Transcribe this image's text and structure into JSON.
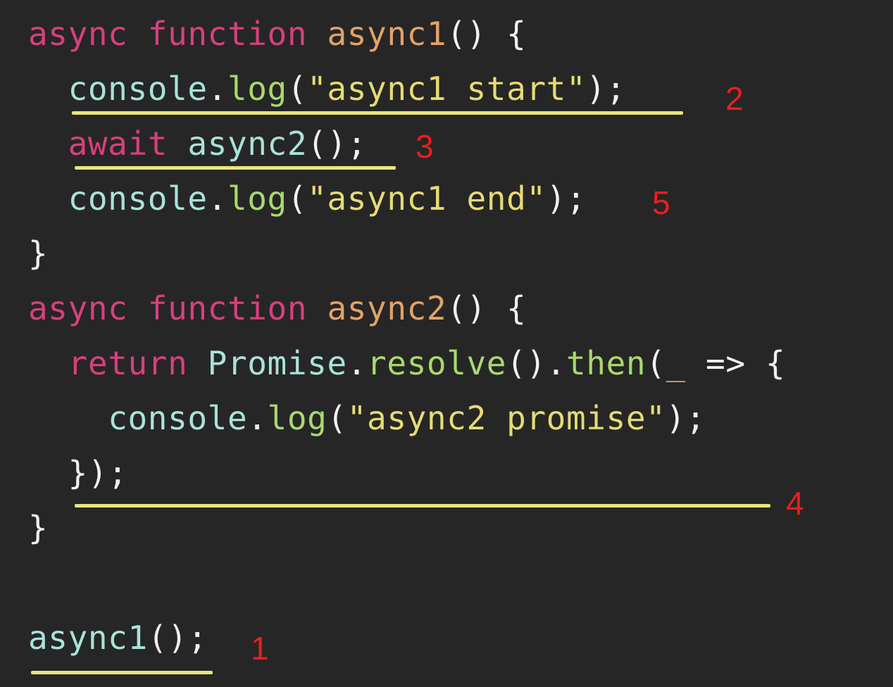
{
  "lines": [
    {
      "id": "line-1",
      "tokens": [
        {
          "text": "async",
          "kind": "keyword"
        },
        {
          "text": " ",
          "kind": "space"
        },
        {
          "text": "function",
          "kind": "keyword"
        },
        {
          "text": " ",
          "kind": "space"
        },
        {
          "text": "async1",
          "kind": "function-name"
        },
        {
          "text": "() {",
          "kind": "punctuation"
        }
      ]
    },
    {
      "id": "line-2",
      "tokens": [
        {
          "text": "  ",
          "kind": "space"
        },
        {
          "text": "console",
          "kind": "identifier"
        },
        {
          "text": ".",
          "kind": "punctuation"
        },
        {
          "text": "log",
          "kind": "method"
        },
        {
          "text": "(",
          "kind": "punctuation"
        },
        {
          "text": "\"async1 start\"",
          "kind": "string"
        },
        {
          "text": ");",
          "kind": "punctuation"
        }
      ]
    },
    {
      "id": "line-3",
      "tokens": [
        {
          "text": "  ",
          "kind": "space"
        },
        {
          "text": "await",
          "kind": "keyword"
        },
        {
          "text": " ",
          "kind": "space"
        },
        {
          "text": "async2",
          "kind": "identifier"
        },
        {
          "text": "();",
          "kind": "punctuation"
        }
      ]
    },
    {
      "id": "line-4",
      "tokens": [
        {
          "text": "  ",
          "kind": "space"
        },
        {
          "text": "console",
          "kind": "identifier"
        },
        {
          "text": ".",
          "kind": "punctuation"
        },
        {
          "text": "log",
          "kind": "method"
        },
        {
          "text": "(",
          "kind": "punctuation"
        },
        {
          "text": "\"async1 end\"",
          "kind": "string"
        },
        {
          "text": ");",
          "kind": "punctuation"
        }
      ]
    },
    {
      "id": "line-5",
      "tokens": [
        {
          "text": "}",
          "kind": "punctuation"
        }
      ]
    },
    {
      "id": "line-6",
      "tokens": [
        {
          "text": "async",
          "kind": "keyword"
        },
        {
          "text": " ",
          "kind": "space"
        },
        {
          "text": "function",
          "kind": "keyword"
        },
        {
          "text": " ",
          "kind": "space"
        },
        {
          "text": "async2",
          "kind": "function-name"
        },
        {
          "text": "() {",
          "kind": "punctuation"
        }
      ]
    },
    {
      "id": "line-7",
      "tokens": [
        {
          "text": "  ",
          "kind": "space"
        },
        {
          "text": "return",
          "kind": "keyword"
        },
        {
          "text": " ",
          "kind": "space"
        },
        {
          "text": "Promise",
          "kind": "identifier"
        },
        {
          "text": ".",
          "kind": "punctuation"
        },
        {
          "text": "resolve",
          "kind": "method"
        },
        {
          "text": "().",
          "kind": "punctuation"
        },
        {
          "text": "then",
          "kind": "method"
        },
        {
          "text": "(",
          "kind": "punctuation"
        },
        {
          "text": "_",
          "kind": "function-name"
        },
        {
          "text": " => {",
          "kind": "punctuation"
        }
      ]
    },
    {
      "id": "line-8",
      "tokens": [
        {
          "text": "    ",
          "kind": "space"
        },
        {
          "text": "console",
          "kind": "identifier"
        },
        {
          "text": ".",
          "kind": "punctuation"
        },
        {
          "text": "log",
          "kind": "method"
        },
        {
          "text": "(",
          "kind": "punctuation"
        },
        {
          "text": "\"async2 promise\"",
          "kind": "string"
        },
        {
          "text": ");",
          "kind": "punctuation"
        }
      ]
    },
    {
      "id": "line-9",
      "tokens": [
        {
          "text": "  ",
          "kind": "space"
        },
        {
          "text": "});",
          "kind": "punctuation"
        }
      ]
    },
    {
      "id": "line-10",
      "tokens": [
        {
          "text": "}",
          "kind": "punctuation"
        }
      ]
    },
    {
      "id": "line-11",
      "tokens": [
        {
          "text": "",
          "kind": "space"
        }
      ]
    },
    {
      "id": "line-12",
      "tokens": [
        {
          "text": "async1",
          "kind": "identifier"
        },
        {
          "text": "();",
          "kind": "punctuation"
        }
      ]
    }
  ],
  "annotations": [
    {
      "id": "annot-2",
      "text": "2"
    },
    {
      "id": "annot-3",
      "text": "3"
    },
    {
      "id": "annot-5",
      "text": "5"
    },
    {
      "id": "annot-4",
      "text": "4"
    },
    {
      "id": "annot-1",
      "text": "1"
    }
  ],
  "colors": {
    "background": "#262626",
    "keyword": "#d6407d",
    "function_name": "#e2a268",
    "identifier": "#a9e2d8",
    "method": "#a9d86e",
    "string": "#e6db74",
    "punctuation": "#f0f0f0",
    "underline": "#e9e67a",
    "annotation": "#ee1c1c"
  }
}
